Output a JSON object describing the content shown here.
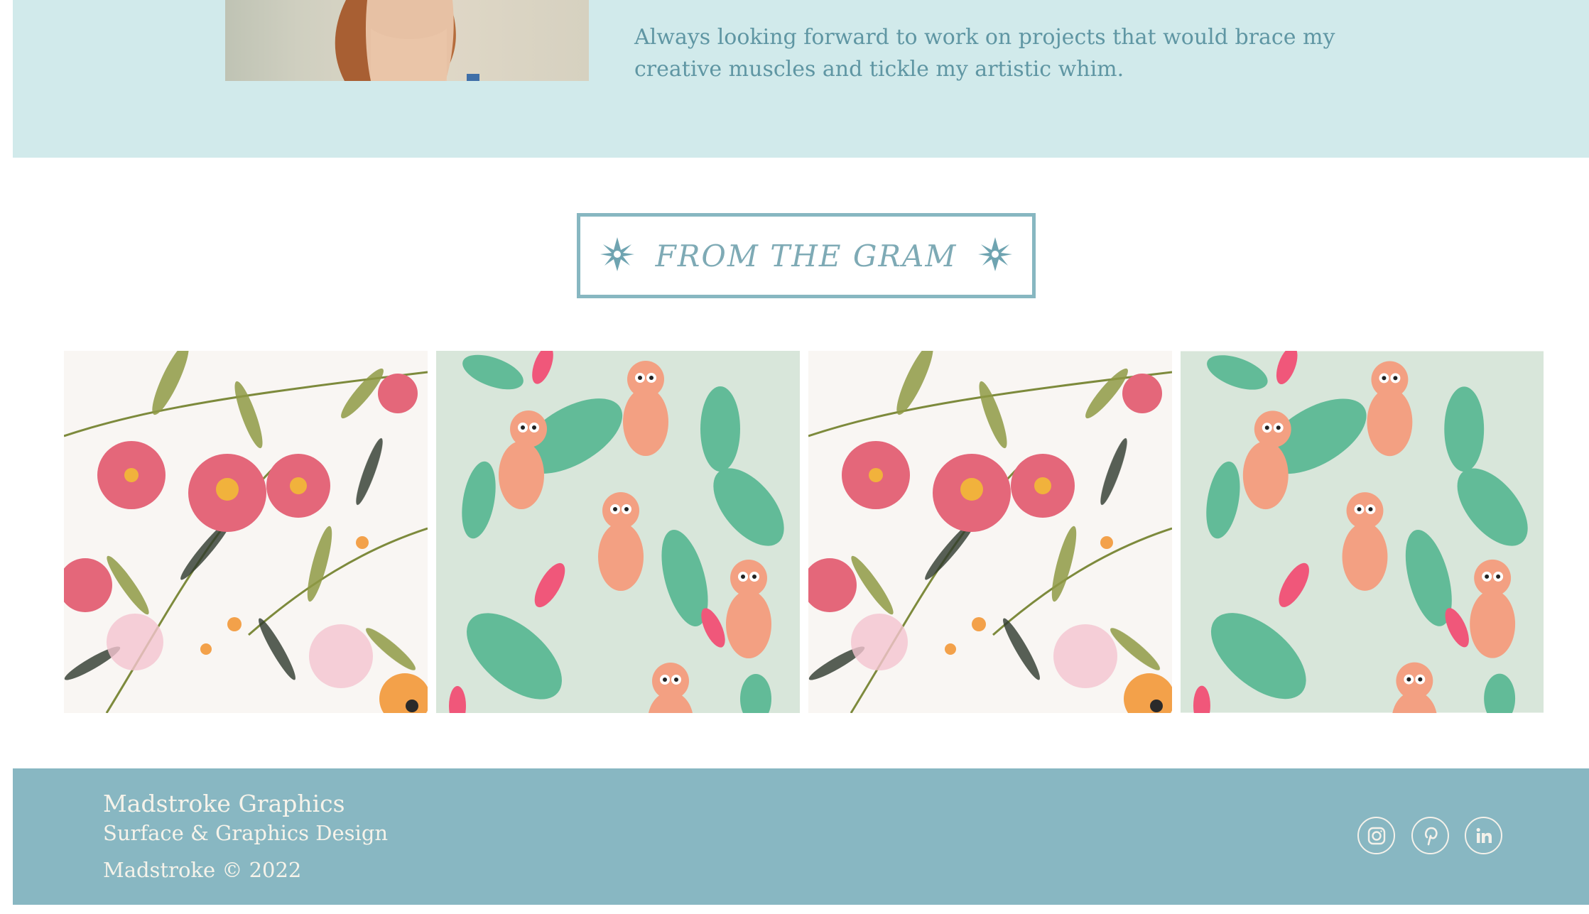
{
  "about": {
    "portrait_alt": "portrait photo",
    "text": "Always looking forward to work on projects that would brace my creative muscles and tickle my artistic whim."
  },
  "gram": {
    "title": "FROM THE GRAM"
  },
  "gallery": [
    {
      "pattern": "floral"
    },
    {
      "pattern": "monkeys"
    },
    {
      "pattern": "floral"
    },
    {
      "pattern": "monkeys"
    }
  ],
  "footer": {
    "brand": "Madstroke Graphics",
    "tagline": "Surface & Graphics Design",
    "copyright": "Madstroke © 2022",
    "social": [
      "instagram-icon",
      "pinterest-icon",
      "linkedin-icon"
    ]
  },
  "colors": {
    "about_bg": "#d1eaeb",
    "accent": "#87b7c1",
    "footer_bg": "#88b7c2",
    "footer_text": "#f6f3ea"
  }
}
